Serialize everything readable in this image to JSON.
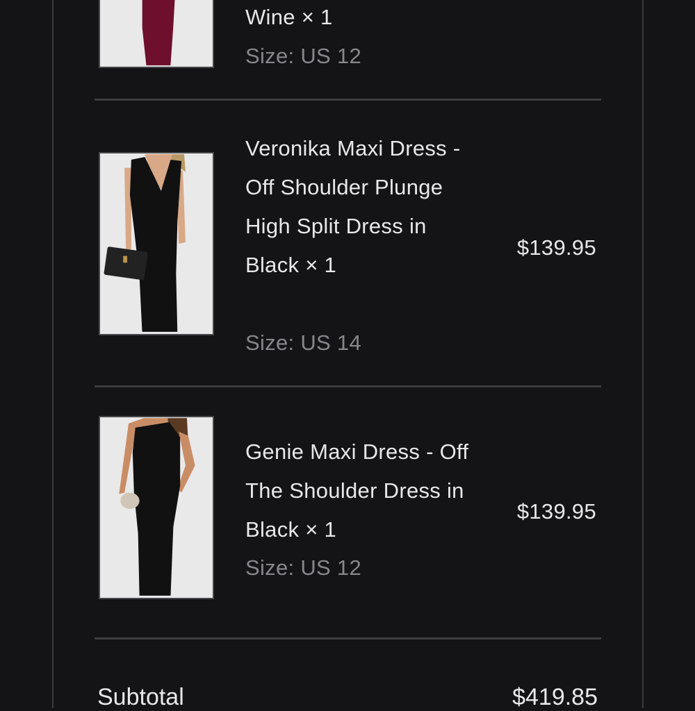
{
  "items": [
    {
      "name": "Wine × 1",
      "size": "Size: US 12",
      "price": "",
      "image_color": "#6e0f2e"
    },
    {
      "name": "Veronika Maxi Dress - Off Shoulder Plunge High Split Dress in Black × 1",
      "size": "Size: US 14",
      "price": "$139.95",
      "image_color": "#111111"
    },
    {
      "name": "Genie Maxi Dress - Off The Shoulder Dress in Black × 1",
      "size": "Size: US 12",
      "price": "$139.95",
      "image_color": "#111111"
    }
  ],
  "summary": {
    "subtotal_label": "Subtotal",
    "subtotal_value": "$419.85"
  },
  "colors": {
    "background": "#141416",
    "text_primary": "#e8e8ea",
    "text_secondary": "#87878c",
    "divider": "#3d3d40"
  }
}
